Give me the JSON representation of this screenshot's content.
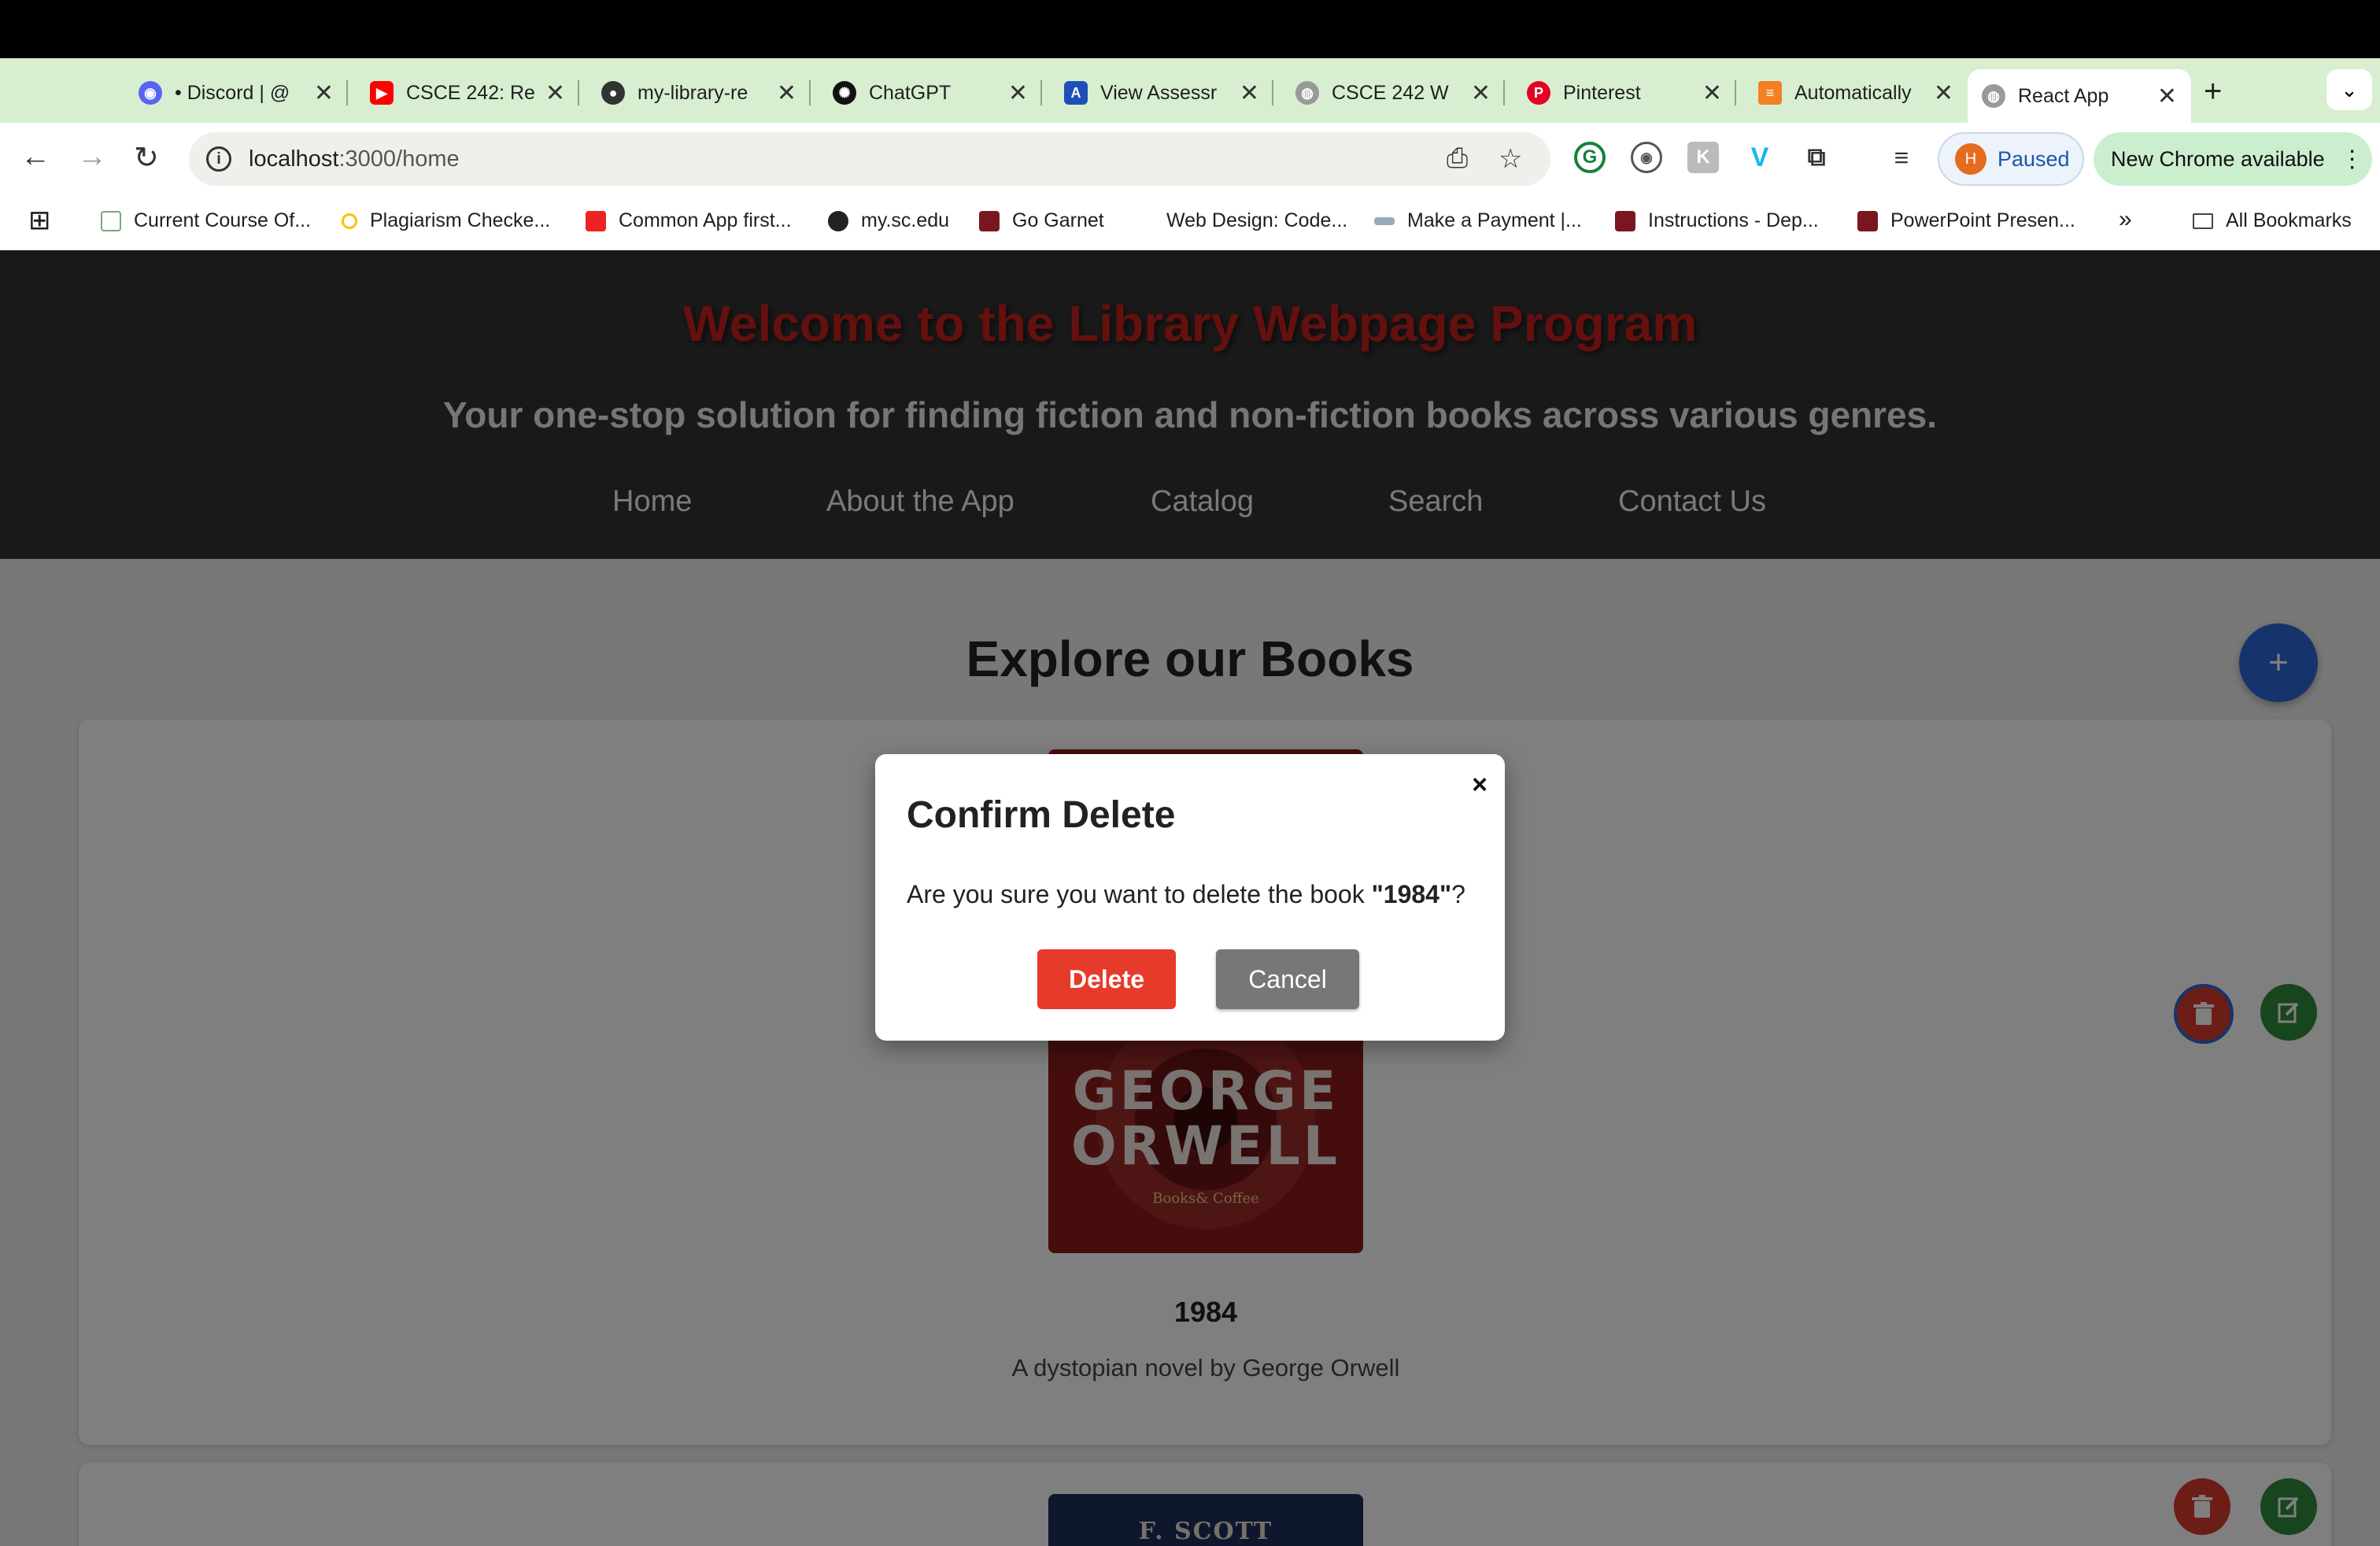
{
  "browser": {
    "tabs": [
      {
        "title": "• Discord | @",
        "icon": "discord-icon",
        "color": "#5865f2"
      },
      {
        "title": "CSCE 242: Re",
        "icon": "youtube-icon",
        "color": "#ff0000"
      },
      {
        "title": "my-library-re",
        "icon": "github-icon",
        "color": "#333333"
      },
      {
        "title": "ChatGPT",
        "icon": "chatgpt-icon",
        "color": "#111111"
      },
      {
        "title": "View Assessr",
        "icon": "assessment-icon",
        "color": "#1e4fb8"
      },
      {
        "title": "CSCE 242 W",
        "icon": "globe-icon",
        "color": "#999999"
      },
      {
        "title": "Pinterest",
        "icon": "pinterest-icon",
        "color": "#e60023"
      },
      {
        "title": "Automatically",
        "icon": "stack-icon",
        "color": "#f48024"
      },
      {
        "title": "React App",
        "icon": "globe-icon",
        "color": "#999999"
      }
    ],
    "url_host": "localhost",
    "url_path": ":3000/home",
    "profile_initial": "H",
    "profile_status": "Paused",
    "update_label": "New Chrome available",
    "bookmarks": [
      "Current Course Of...",
      "Plagiarism Checke...",
      "Common App first...",
      "my.sc.edu",
      "Go Garnet",
      "Web Design: Code...",
      "Make a Payment |...",
      "Instructions - Dep...",
      "PowerPoint Presen..."
    ],
    "more_bookmarks": "»",
    "all_bookmarks": "All Bookmarks"
  },
  "hero": {
    "title": "Welcome to the Library Webpage Program",
    "subtitle": "Your one-stop solution for finding fiction and non-fiction books across various genres.",
    "nav": [
      "Home",
      "About the App",
      "Catalog",
      "Search",
      "Contact Us"
    ]
  },
  "main": {
    "heading": "Explore our Books",
    "add_label": "+",
    "books": [
      {
        "title": "1984",
        "description": "A dystopian novel by George Orwell",
        "cover_author": "GEORGE ORWELL",
        "cover_publisher": "Books& Coffee"
      },
      {
        "cover_author": "F. SCOTT FITZGERALD"
      }
    ]
  },
  "modal": {
    "title": "Confirm Delete",
    "message_prefix": "Are you sure you want to delete the book ",
    "book": "\"1984\"",
    "message_suffix": "?",
    "close": "×",
    "delete_label": "Delete",
    "cancel_label": "Cancel"
  },
  "colors": {
    "accent_blue": "#2f66d6",
    "danger": "#e63a2b",
    "edit_green": "#2e8b3a",
    "hero_bg": "#333333",
    "title_red": "#c7211d"
  }
}
